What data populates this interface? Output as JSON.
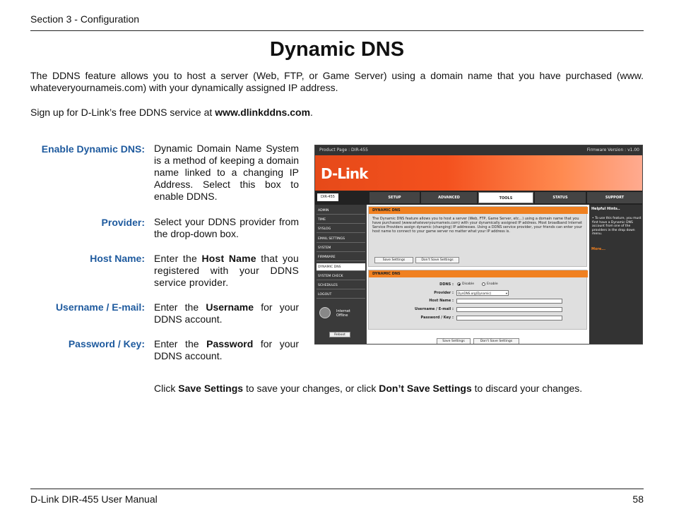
{
  "header": {
    "section": "Section 3 - Configuration"
  },
  "title": "Dynamic DNS",
  "intro": {
    "line1": "The DDNS feature allows you to host a server (Web, FTP, or Game Server) using a domain name that you have purchased (www.",
    "line2": "whateveryournameis.com) with your dynamically assigned IP address."
  },
  "signup": {
    "prefix": "Sign up for D-Link’s free DDNS service at ",
    "link": "www.dlinkddns.com",
    "suffix": "."
  },
  "fields": [
    {
      "label": "Enable Dynamic DNS:",
      "desc": "Dynamic Domain Name System is a method of keeping a domain name linked to a changing IP Address. Select this box to enable DDNS."
    },
    {
      "label": "Provider:",
      "desc": "Select your DDNS provider from the drop-down box."
    },
    {
      "label": "Host Name:",
      "pre": "Enter the ",
      "bold": "Host Name",
      "post": " that you registered with your DDNS service provider."
    },
    {
      "label": "Username / E-mail:",
      "pre": "Enter the ",
      "bold": "Username",
      "post": " for your DDNS account."
    },
    {
      "label": "Password / Key:",
      "pre": "Enter the ",
      "bold": "Password",
      "post": " for your DDNS account."
    }
  ],
  "closing": {
    "p1": "Click ",
    "b1": "Save Settings",
    "p2": " to save your changes, or click ",
    "b2": "Don’t Save Settings",
    "p3": " to discard your changes."
  },
  "footer": {
    "manual": "D-Link DIR-455 User Manual",
    "page": "58"
  },
  "screenshot": {
    "product": "Product Page :  DIR-455",
    "firmware": "Firmware Version : v1.00",
    "logo": "D-Link",
    "model": "DIR-455",
    "tabs": [
      "SETUP",
      "ADVANCED",
      "TOOLS",
      "STATUS",
      "SUPPORT"
    ],
    "side": [
      "ADMIN",
      "TIME",
      "SYSLOG",
      "EMAIL SETTINGS",
      "SYSTEM",
      "FIRMWARE",
      "DYNAMIC DNS",
      "SYSTEM CHECK",
      "SCHEDULES",
      "LOGOUT"
    ],
    "offline1": "Internet",
    "offline2": "Offline",
    "reboot": "Reboot",
    "section1": "DYNAMIC DNS",
    "desc": "The Dynamic DNS feature allows you to host a server (Web, FTP, Game Server, etc...) using a domain name that you have purchased (www.whateveryournameis.com) with your dynamically assigned IP address. Most broadband Internet Service Providers assign dynamic (changing) IP addresses. Using a DDNS service provider, your friends can enter your host name to connect to your game server no matter what your IP address is.",
    "save": "Save Settings",
    "dontsave": "Don't Save Settings",
    "section2": "DYNAMIC DNS",
    "ddns_label": "DDNS :",
    "disable": "Disable",
    "enable": "Enable",
    "provider_label": "Provider :",
    "provider_value": "DynDNS.org(Dynamic)",
    "host_label": "Host Name :",
    "user_label": "Username / E-mail :",
    "pass_label": "Password / Key :",
    "help_title": "Helpful Hints..",
    "help_body": "• To use this feature, you must first have a Dynamic DNS account from one of the providers in the drop down menu.",
    "help_more": "More..."
  }
}
